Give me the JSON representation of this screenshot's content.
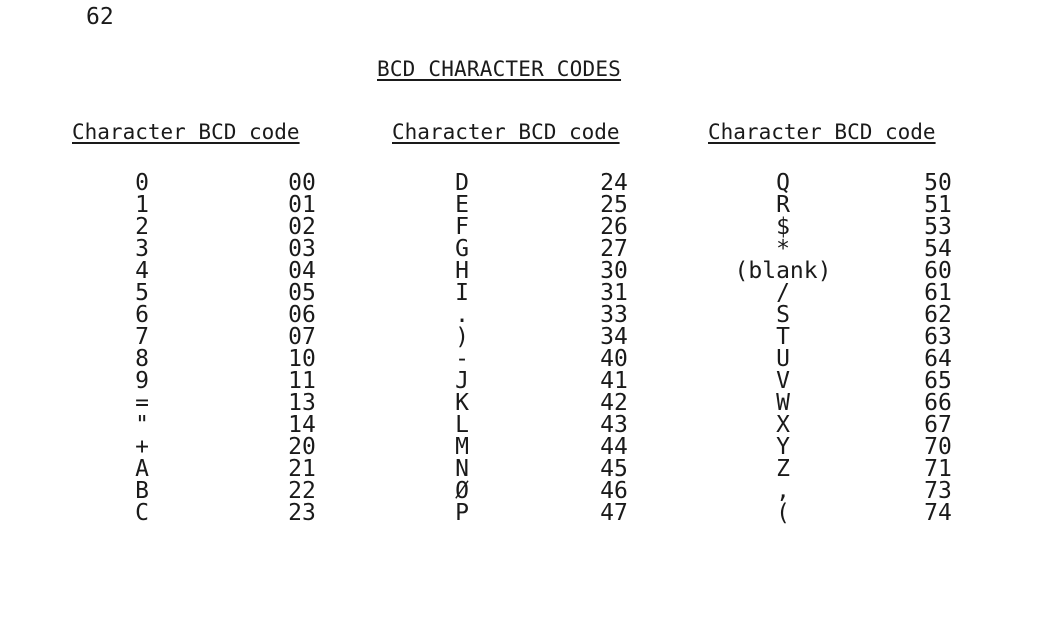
{
  "page_number": "62",
  "title": "BCD CHARACTER CODES",
  "column_header": "Character BCD code",
  "groups": [
    {
      "rows": [
        {
          "character": "0",
          "code": "00"
        },
        {
          "character": "1",
          "code": "01"
        },
        {
          "character": "2",
          "code": "02"
        },
        {
          "character": "3",
          "code": "03"
        },
        {
          "character": "4",
          "code": "04"
        },
        {
          "character": "5",
          "code": "05"
        },
        {
          "character": "6",
          "code": "06"
        },
        {
          "character": "7",
          "code": "07"
        },
        {
          "character": "8",
          "code": "10"
        },
        {
          "character": "9",
          "code": "11"
        },
        {
          "character": "=",
          "code": "13"
        },
        {
          "character": "\"",
          "code": "14"
        },
        {
          "character": "+",
          "code": "20"
        },
        {
          "character": "A",
          "code": "21"
        },
        {
          "character": "B",
          "code": "22"
        },
        {
          "character": "C",
          "code": "23"
        }
      ]
    },
    {
      "rows": [
        {
          "character": "D",
          "code": "24"
        },
        {
          "character": "E",
          "code": "25"
        },
        {
          "character": "F",
          "code": "26"
        },
        {
          "character": "G",
          "code": "27"
        },
        {
          "character": "H",
          "code": "30"
        },
        {
          "character": "I",
          "code": "31"
        },
        {
          "character": ".",
          "code": "33"
        },
        {
          "character": ")",
          "code": "34"
        },
        {
          "character": "-",
          "code": "40"
        },
        {
          "character": "J",
          "code": "41"
        },
        {
          "character": "K",
          "code": "42"
        },
        {
          "character": "L",
          "code": "43"
        },
        {
          "character": "M",
          "code": "44"
        },
        {
          "character": "N",
          "code": "45"
        },
        {
          "character": "Ø",
          "code": "46"
        },
        {
          "character": "P",
          "code": "47"
        }
      ]
    },
    {
      "rows": [
        {
          "character": "Q",
          "code": "50"
        },
        {
          "character": "R",
          "code": "51"
        },
        {
          "character": "$",
          "code": "53"
        },
        {
          "character": "*",
          "code": "54"
        },
        {
          "character": "(blank)",
          "code": "60"
        },
        {
          "character": "/",
          "code": "61"
        },
        {
          "character": "S",
          "code": "62"
        },
        {
          "character": "T",
          "code": "63"
        },
        {
          "character": "U",
          "code": "64"
        },
        {
          "character": "V",
          "code": "65"
        },
        {
          "character": "W",
          "code": "66"
        },
        {
          "character": "X",
          "code": "67"
        },
        {
          "character": "Y",
          "code": "70"
        },
        {
          "character": "Z",
          "code": "71"
        },
        {
          "character": ",",
          "code": "73"
        },
        {
          "character": "(",
          "code": "74"
        }
      ]
    }
  ]
}
